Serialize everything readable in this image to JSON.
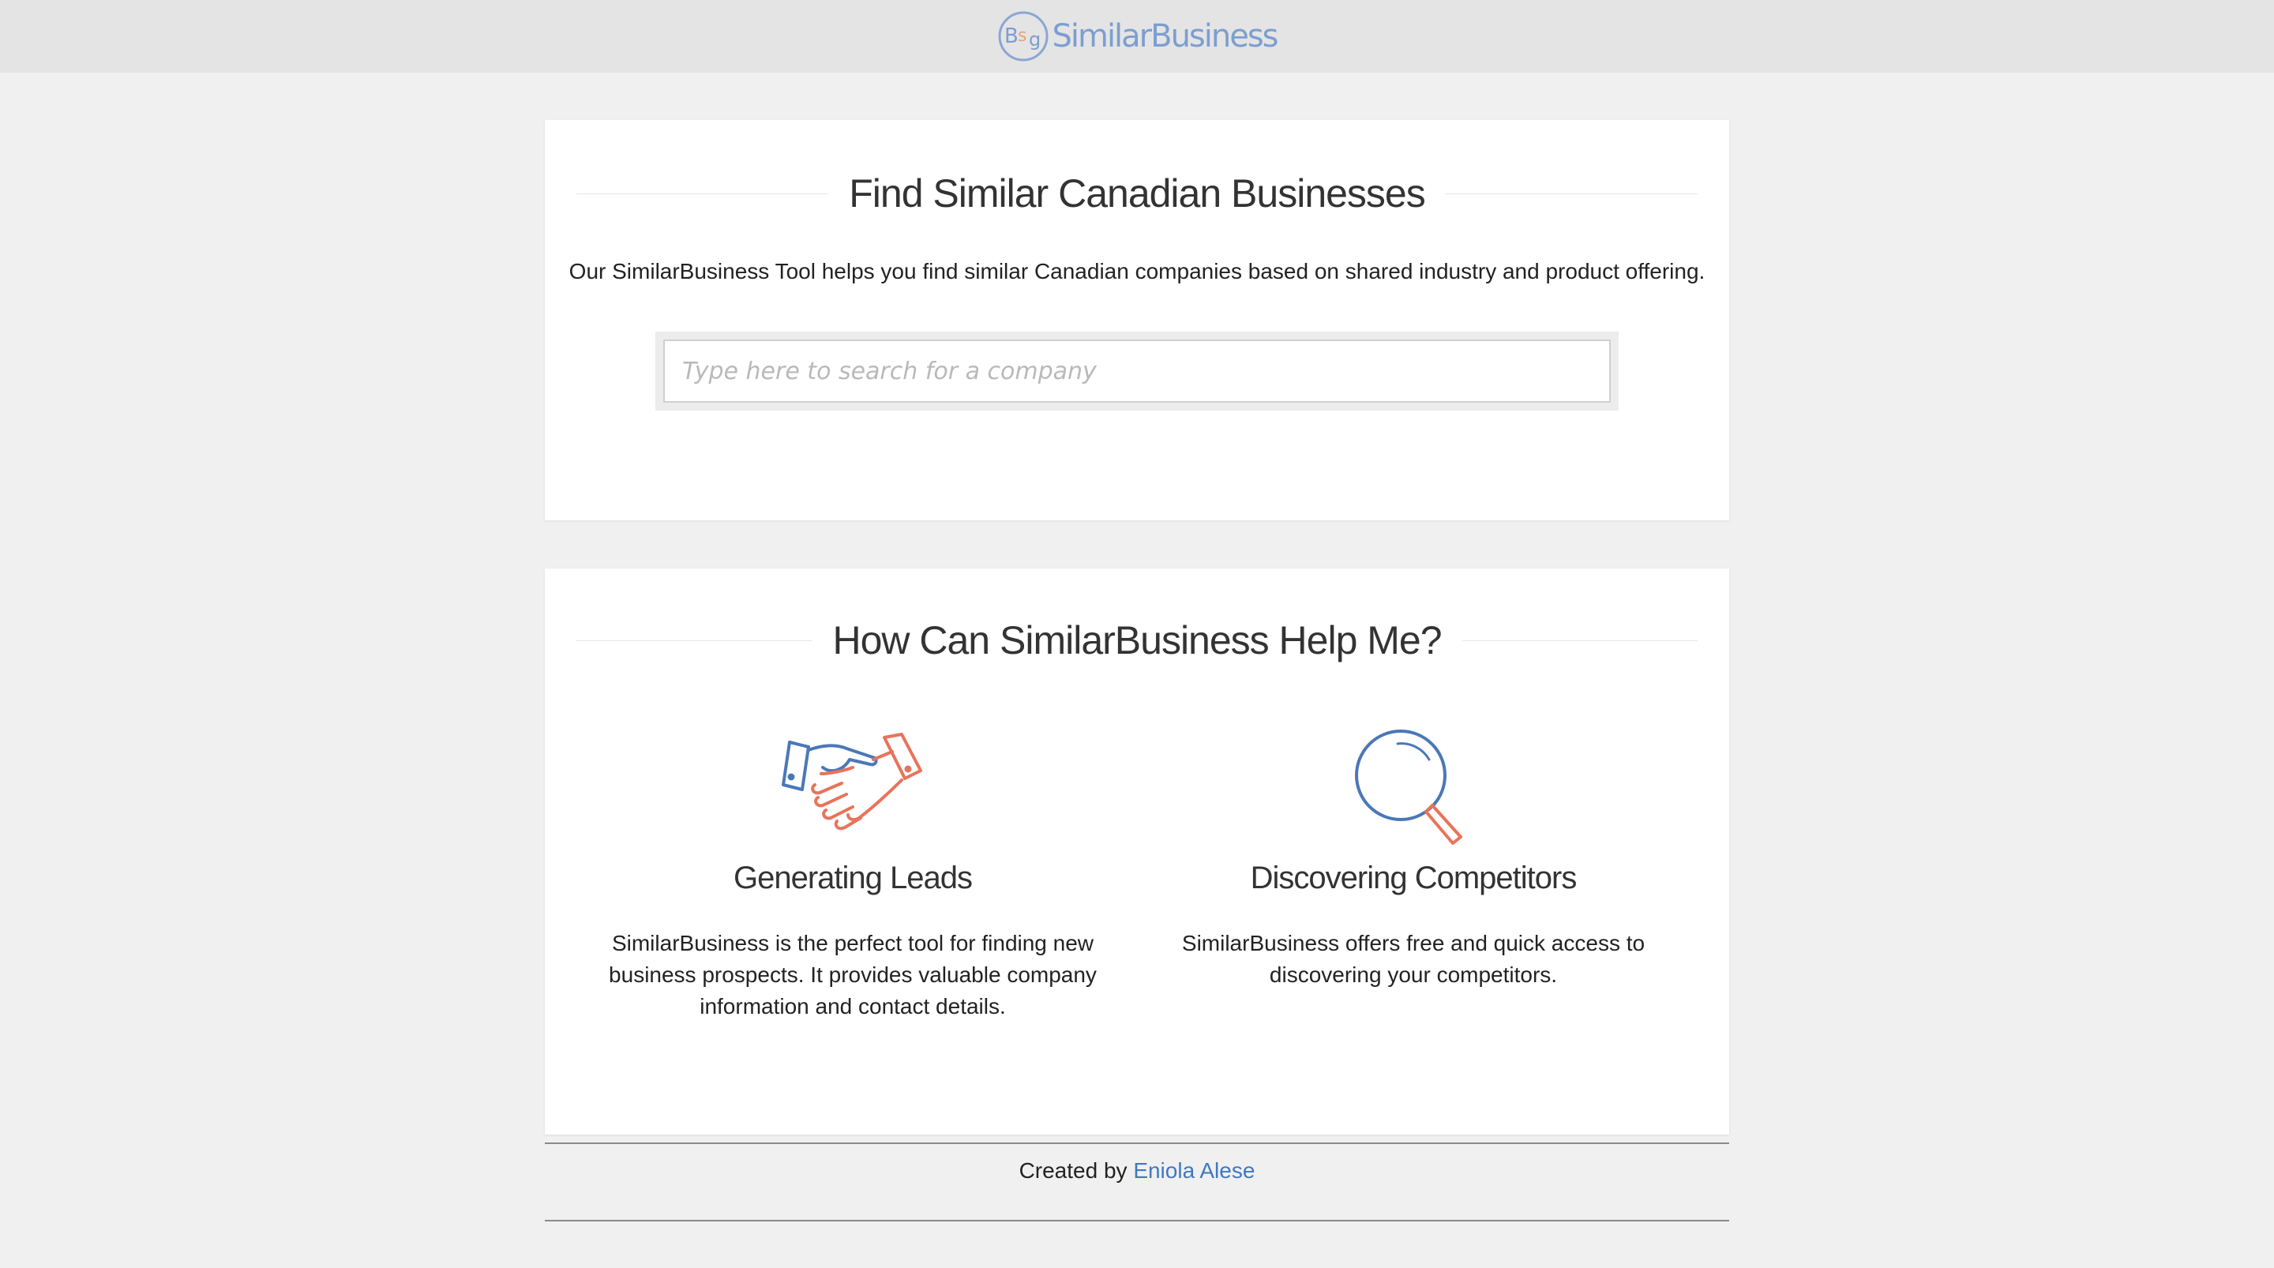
{
  "header": {
    "logo_text": "SimilarBusiness",
    "logo_letters": [
      "B",
      "s",
      "g"
    ]
  },
  "search_card": {
    "title": "Find Similar Canadian Businesses",
    "intro": "Our SimilarBusiness Tool helps you find similar Canadian companies based on shared industry and product offering.",
    "search_value": "",
    "search_placeholder": "Type here to search for a company"
  },
  "help_card": {
    "title": "How Can SimilarBusiness Help Me?",
    "features": [
      {
        "icon": "handshake-icon",
        "title": "Generating Leads",
        "description": "SimilarBusiness is the perfect tool for finding new business prospects. It provides valuable company information and contact details."
      },
      {
        "icon": "magnifying-glass-icon",
        "title": "Discovering Competitors",
        "description": "SimilarBusiness offers free and quick access to discovering your competitors."
      }
    ]
  },
  "footer": {
    "prefix": "Created by ",
    "author_link": "Eniola Alese"
  },
  "colors": {
    "brand_blue": "#4a78b8",
    "accent_orange": "#e8735a",
    "logo_text": "#7c9ed0",
    "link": "#3f78c2"
  }
}
